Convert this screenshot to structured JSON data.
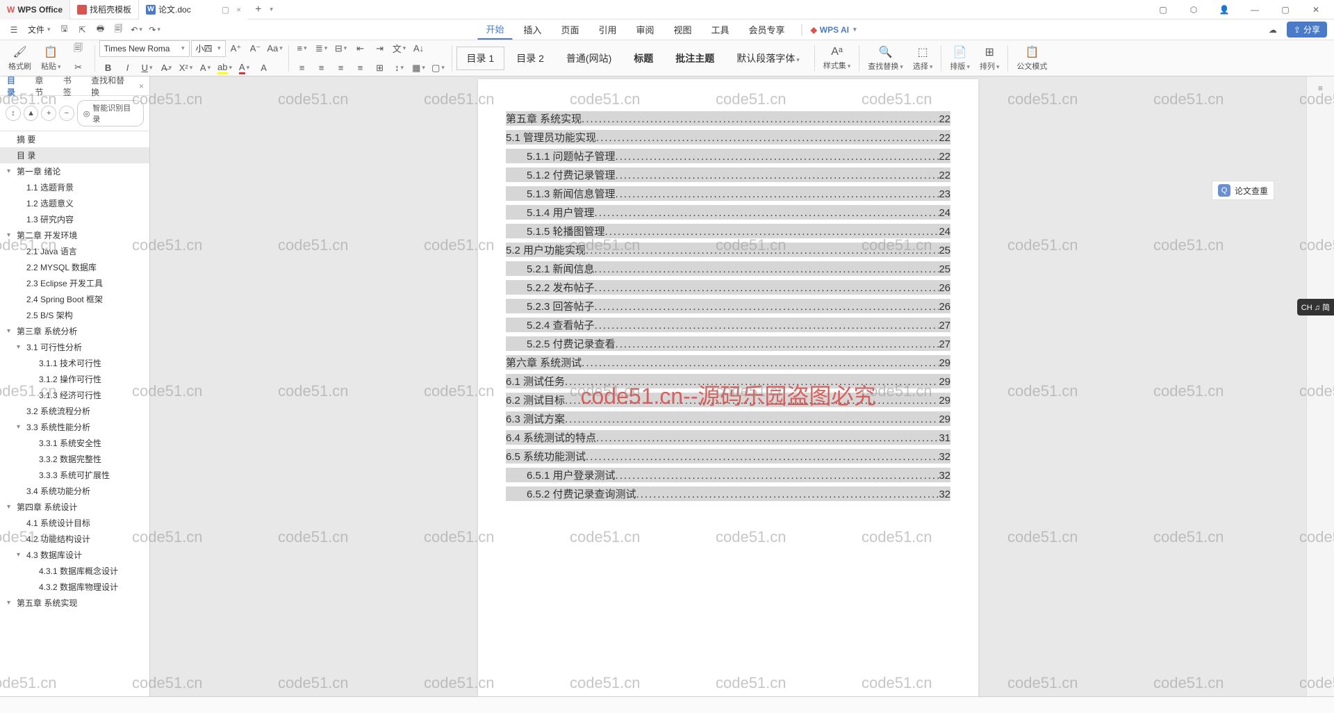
{
  "titlebar": {
    "app_name": "WPS Office",
    "template_tab": "找稻壳模板",
    "doc_tab": "论文.doc"
  },
  "file_menu": "文件",
  "menu_tabs": {
    "start": "开始",
    "insert": "插入",
    "page": "页面",
    "ref": "引用",
    "review": "审阅",
    "view": "视图",
    "tools": "工具",
    "vip": "会员专享"
  },
  "wps_ai": "WPS AI",
  "share": "分享",
  "toolbar": {
    "format_painter": "格式刷",
    "paste": "粘贴",
    "font_name": "Times New Roma",
    "font_size": "小四",
    "style_toc1": "目录 1",
    "style_toc2": "目录 2",
    "style_normal": "普通(网站)",
    "style_title": "标题",
    "style_ann_title": "批注主题",
    "style_default": "默认段落字体",
    "style_set": "样式集",
    "find_replace": "查找替换",
    "select": "选择",
    "layout": "排版",
    "arrange": "排列",
    "official": "公文模式"
  },
  "sidebar": {
    "tab_toc": "目录",
    "tab_chapter": "章节",
    "tab_bookmark": "书签",
    "tab_find": "查找和替换",
    "smart_toc": "智能识别目录",
    "items": [
      {
        "lvl": 0,
        "label": "摘 要"
      },
      {
        "lvl": 0,
        "label": "目 录",
        "selected": true
      },
      {
        "lvl": 0,
        "label": "第一章 绪论",
        "caret": true
      },
      {
        "lvl": 1,
        "label": "1.1 选题背景"
      },
      {
        "lvl": 1,
        "label": "1.2 选题意义"
      },
      {
        "lvl": 1,
        "label": "1.3 研究内容"
      },
      {
        "lvl": 0,
        "label": "第二章 开发环境",
        "caret": true
      },
      {
        "lvl": 1,
        "label": "2.1 Java 语言"
      },
      {
        "lvl": 1,
        "label": "2.2 MYSQL 数据库"
      },
      {
        "lvl": 1,
        "label": "2.3 Eclipse 开发工具"
      },
      {
        "lvl": 1,
        "label": "2.4 Spring Boot 框架"
      },
      {
        "lvl": 1,
        "label": "2.5 B/S 架构"
      },
      {
        "lvl": 0,
        "label": "第三章 系统分析",
        "caret": true
      },
      {
        "lvl": 1,
        "label": "3.1 可行性分析",
        "caret": true
      },
      {
        "lvl": 2,
        "label": "3.1.1 技术可行性"
      },
      {
        "lvl": 2,
        "label": "3.1.2 操作可行性"
      },
      {
        "lvl": 2,
        "label": "3.1.3 经济可行性"
      },
      {
        "lvl": 1,
        "label": "3.2 系统流程分析"
      },
      {
        "lvl": 1,
        "label": "3.3 系统性能分析",
        "caret": true
      },
      {
        "lvl": 2,
        "label": "3.3.1 系统安全性"
      },
      {
        "lvl": 2,
        "label": "3.3.2 数据完整性"
      },
      {
        "lvl": 2,
        "label": "3.3.3 系统可扩展性"
      },
      {
        "lvl": 1,
        "label": "3.4 系统功能分析"
      },
      {
        "lvl": 0,
        "label": "第四章 系统设计",
        "caret": true
      },
      {
        "lvl": 1,
        "label": "4.1 系统设计目标"
      },
      {
        "lvl": 1,
        "label": "4.2 功能结构设计"
      },
      {
        "lvl": 1,
        "label": "4.3 数据库设计",
        "caret": true
      },
      {
        "lvl": 2,
        "label": "4.3.1 数据库概念设计"
      },
      {
        "lvl": 2,
        "label": "4.3.2 数据库物理设计"
      },
      {
        "lvl": 0,
        "label": "第五章 系统实现",
        "caret": true
      }
    ]
  },
  "toc": [
    {
      "cls": "h1",
      "title": "第五章 系统实现",
      "pg": "22"
    },
    {
      "cls": "h2",
      "title": "5.1 管理员功能实现",
      "pg": "22"
    },
    {
      "cls": "h3",
      "title": "5.1.1 问题帖子管理",
      "pg": "22"
    },
    {
      "cls": "h3",
      "title": "5.1.2 付费记录管理",
      "pg": "22"
    },
    {
      "cls": "h3",
      "title": "5.1.3 新闻信息管理",
      "pg": "23"
    },
    {
      "cls": "h3",
      "title": "5.1.4 用户管理",
      "pg": "24"
    },
    {
      "cls": "h3",
      "title": "5.1.5 轮播图管理",
      "pg": "24"
    },
    {
      "cls": "h2",
      "title": "5.2 用户功能实现",
      "pg": "25"
    },
    {
      "cls": "h3",
      "title": "5.2.1 新闻信息",
      "pg": "25"
    },
    {
      "cls": "h3",
      "title": "5.2.2 发布帖子",
      "pg": "26"
    },
    {
      "cls": "h3",
      "title": "5.2.3 回答帖子",
      "pg": "26"
    },
    {
      "cls": "h3",
      "title": "5.2.4 查看帖子",
      "pg": "27"
    },
    {
      "cls": "h3",
      "title": "5.2.5 付费记录查看",
      "pg": "27"
    },
    {
      "cls": "h1",
      "title": "第六章 系统测试",
      "pg": "29"
    },
    {
      "cls": "h2",
      "title": "6.1 测试任务",
      "pg": "29"
    },
    {
      "cls": "h2",
      "title": "6.2 测试目标",
      "pg": "29"
    },
    {
      "cls": "h2",
      "title": "6.3 测试方案",
      "pg": "29"
    },
    {
      "cls": "h2",
      "title": "6.4 系统测试的特点",
      "pg": "31"
    },
    {
      "cls": "h2",
      "title": "6.5 系统功能测试",
      "pg": "32"
    },
    {
      "cls": "h3",
      "title": "6.5.1 用户登录测试",
      "pg": "32"
    },
    {
      "cls": "h3",
      "title": "6.5.2 付费记录查询测试",
      "pg": "32"
    }
  ],
  "watermark": "code51.cn",
  "big_watermark": "code51.cn--源码乐园盗图必究",
  "rail_label": "论文查重",
  "ime_badge": "CH ♫ 简"
}
